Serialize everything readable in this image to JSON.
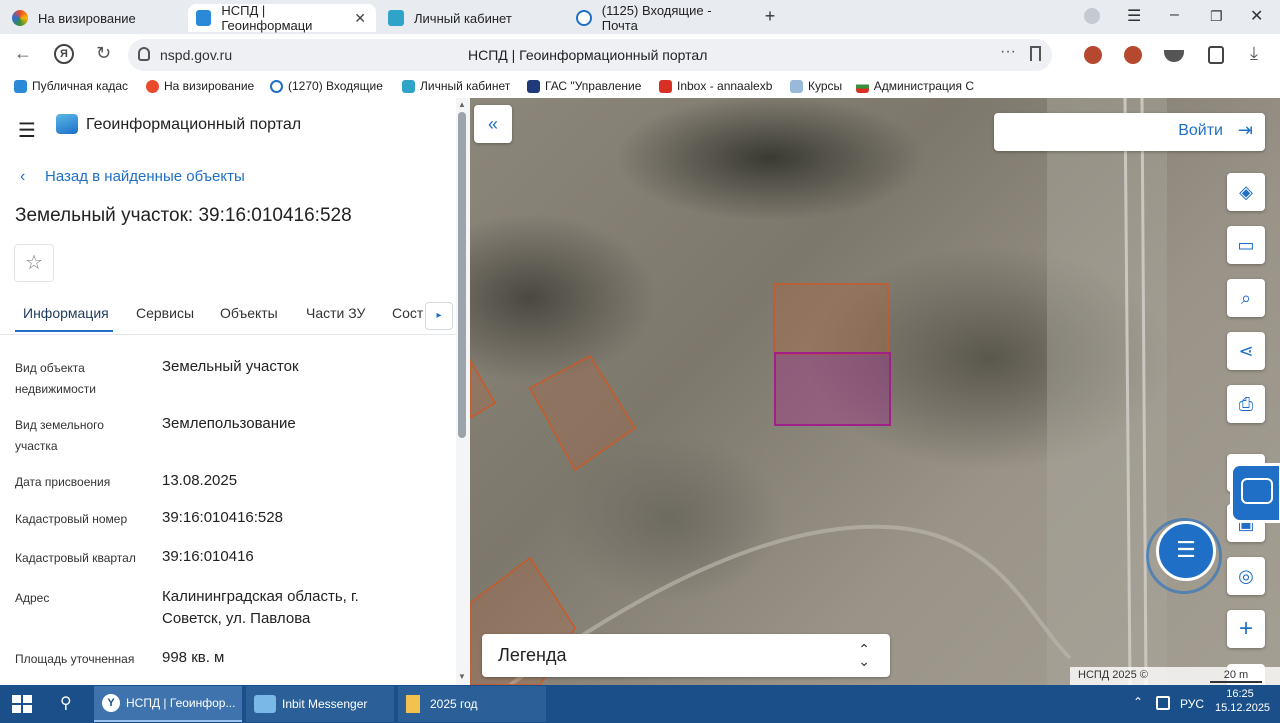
{
  "browser": {
    "tabs": [
      {
        "label": "На визирование",
        "active": false
      },
      {
        "label": "НСПД | Геоинформаци",
        "active": true
      },
      {
        "label": "Личный кабинет",
        "active": false
      },
      {
        "label": "(1125) Входящие - Почта",
        "active": false
      }
    ],
    "new_tab": "+",
    "url": "nspd.gov.ru",
    "page_title": "НСПД | Геоинформационный портал",
    "bookmarks": [
      "Публичная кадас",
      "На визирование",
      "(1270) Входящие",
      "Личный кабинет",
      "ГАС \"Управление",
      "Inbox - annaalexb",
      "Курсы",
      "Администрация С"
    ]
  },
  "panel": {
    "portal_title": "Геоинформационный портал",
    "back_link": "Назад в найденные объекты",
    "object_title": "Земельный участок: 39:16:010416:528",
    "tabs": [
      "Информация",
      "Сервисы",
      "Объекты",
      "Части ЗУ",
      "Сост"
    ],
    "fields": [
      {
        "label": "Вид объекта недвижимости",
        "value": "Земельный участок"
      },
      {
        "label": "Вид земельного участка",
        "value": "Землепользование"
      },
      {
        "label": "Дата присвоения",
        "value": "13.08.2025"
      },
      {
        "label": "Кадастровый номер",
        "value": "39:16:010416:528"
      },
      {
        "label": "Кадастровый квартал",
        "value": "39:16:010416"
      },
      {
        "label": "Адрес",
        "value": "Калининградская область, г. Советск, ул. Павлова"
      },
      {
        "label": "Площадь уточненная",
        "value": "998 кв. м"
      }
    ]
  },
  "map": {
    "login": "Войти",
    "legend": "Легенда",
    "copyright": "НСПД 2025 ©",
    "scale": "20 m"
  },
  "taskbar": {
    "tasks": [
      "НСПД | Геоинфор...",
      "Inbit Messenger",
      "2025 год"
    ],
    "lang": "РУС",
    "time": "16:25",
    "date": "15.12.2025"
  },
  "colors": {
    "accent": "#1f6fc7",
    "taskbar": "#1a4f8a",
    "parcel_selected": "#a0208a",
    "parcel_other": "#c85a28"
  }
}
